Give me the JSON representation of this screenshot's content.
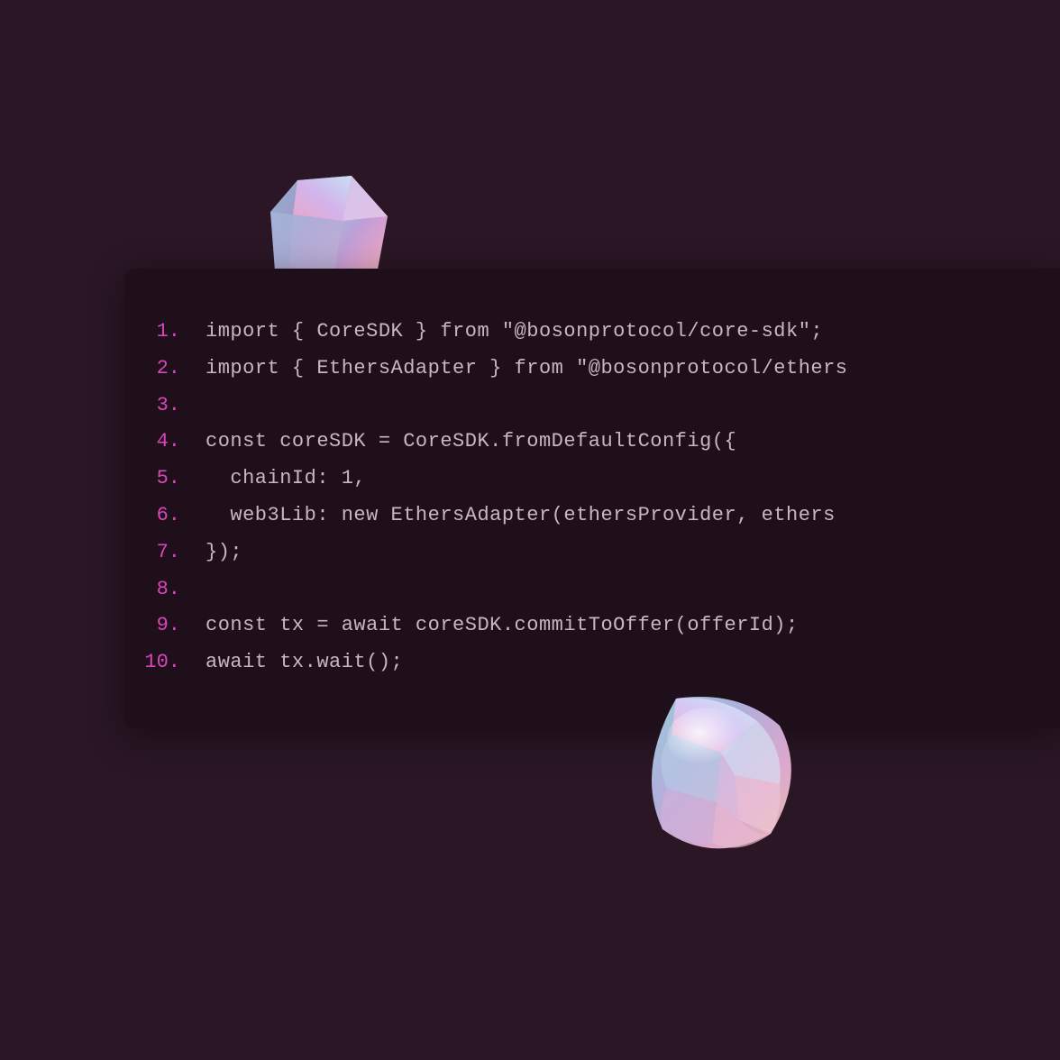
{
  "code": {
    "lines": [
      {
        "n": "1.",
        "text": "import { CoreSDK } from \"@bosonprotocol/core-sdk\";"
      },
      {
        "n": "2.",
        "text": "import { EthersAdapter } from \"@bosonprotocol/ethers"
      },
      {
        "n": "3.",
        "text": ""
      },
      {
        "n": "4.",
        "text": "const coreSDK = CoreSDK.fromDefaultConfig({"
      },
      {
        "n": "5.",
        "text": "  chainId: 1,"
      },
      {
        "n": "6.",
        "text": "  web3Lib: new EthersAdapter(ethersProvider, ethers"
      },
      {
        "n": "7.",
        "text": "});"
      },
      {
        "n": "8.",
        "text": ""
      },
      {
        "n": "9.",
        "text": "const tx = await coreSDK.commitToOffer(offerId);"
      },
      {
        "n": "10.",
        "text": "await tx.wait();"
      }
    ]
  },
  "decorations": {
    "gem_top": "crystal-gem",
    "gem_bottom": "crystal-gem"
  }
}
